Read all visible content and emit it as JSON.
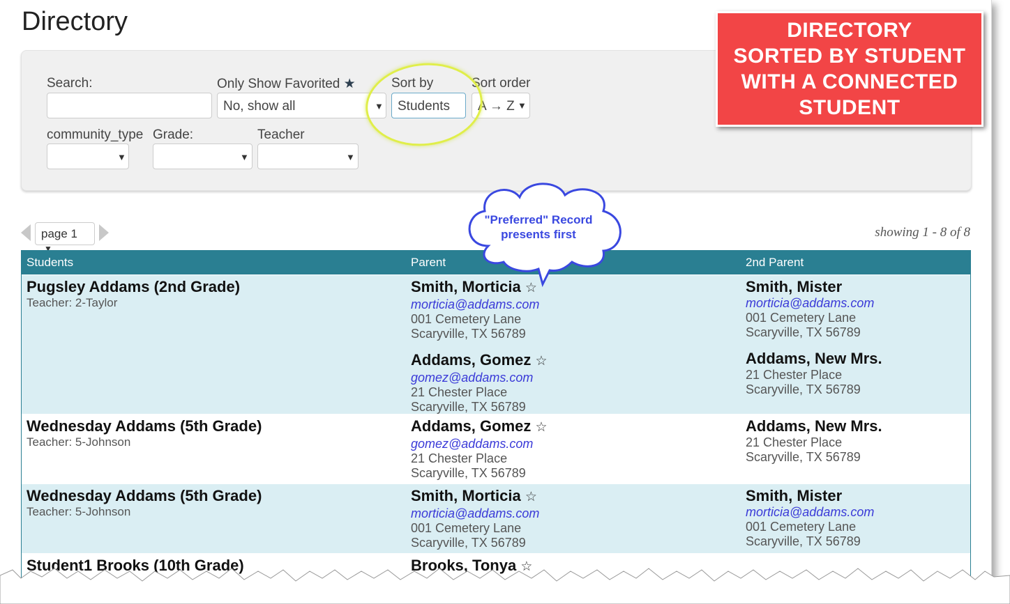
{
  "page": {
    "title": "Directory"
  },
  "filters": {
    "search": {
      "label": "Search:",
      "value": "",
      "placeholder": ""
    },
    "favorited": {
      "label": "Only Show Favorited",
      "icon": "star-icon",
      "value": "No, show all"
    },
    "sort_by": {
      "label": "Sort by",
      "value": "Students"
    },
    "sort_order": {
      "label": "Sort order",
      "value": "A → Z"
    },
    "community_type": {
      "label": "community_type",
      "value": ""
    },
    "grade": {
      "label": "Grade:",
      "value": ""
    },
    "teacher": {
      "label": "Teacher",
      "value": ""
    }
  },
  "callout": {
    "lines": [
      "DIRECTORY",
      "SORTED BY STUDENT",
      "WITH A CONNECTED",
      "STUDENT"
    ],
    "color": "#f24546"
  },
  "bubble": {
    "lines": [
      "\"Preferred\" Record",
      "presents first"
    ],
    "color": "#3a48e0"
  },
  "pager": {
    "page": "page 1",
    "showing": "showing 1 - 8 of 8"
  },
  "table": {
    "header_color": "#2a7f92",
    "columns": [
      "Students",
      "Parent",
      "2nd Parent"
    ],
    "rows": [
      {
        "student": "Pugsley Addams (2nd Grade)",
        "teacher": "Teacher: 2-Taylor",
        "parents": [
          {
            "name": "Smith, Morticia",
            "email": "morticia@addams.com",
            "addr1": "001 Cemetery Lane",
            "addr2": "Scaryville, TX 56789"
          },
          {
            "name": "Addams, Gomez",
            "email": "gomez@addams.com",
            "addr1": "21 Chester Place",
            "addr2": "Scaryville, TX 56789"
          }
        ],
        "second": [
          {
            "name": "Smith, Mister",
            "email": "morticia@addams.com",
            "addr1": "001 Cemetery Lane",
            "addr2": "Scaryville, TX 56789"
          },
          {
            "name": "Addams, New Mrs.",
            "addr1": "21 Chester Place",
            "addr2": "Scaryville, TX 56789"
          }
        ]
      },
      {
        "student": "Wednesday Addams (5th Grade)",
        "teacher": "Teacher: 5-Johnson",
        "parents": [
          {
            "name": "Addams, Gomez",
            "email": "gomez@addams.com",
            "addr1": "21 Chester Place",
            "addr2": "Scaryville, TX 56789"
          }
        ],
        "second": [
          {
            "name": "Addams, New Mrs.",
            "addr1": "21 Chester Place",
            "addr2": "Scaryville, TX 56789"
          }
        ]
      },
      {
        "student": "Wednesday Addams (5th Grade)",
        "teacher": "Teacher: 5-Johnson",
        "parents": [
          {
            "name": "Smith, Morticia",
            "email": "morticia@addams.com",
            "addr1": "001 Cemetery Lane",
            "addr2": "Scaryville, TX 56789"
          }
        ],
        "second": [
          {
            "name": "Smith, Mister",
            "email": "morticia@addams.com",
            "addr1": "001 Cemetery Lane",
            "addr2": "Scaryville, TX 56789"
          }
        ]
      },
      {
        "student": "Student1 Brooks (10th Grade)",
        "teacher": "",
        "parents": [
          {
            "name": "Brooks, Tonya"
          }
        ],
        "second": []
      }
    ]
  }
}
